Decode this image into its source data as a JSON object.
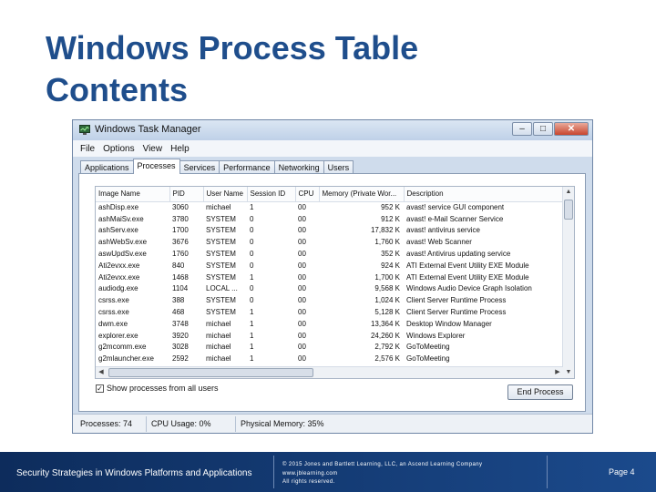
{
  "slide": {
    "title_line1": "Windows Process Table",
    "title_line2": "Contents"
  },
  "window": {
    "title": "Windows Task Manager",
    "minimize_glyph": "–",
    "maximize_glyph": "□",
    "close_glyph": "✕"
  },
  "menu": [
    "File",
    "Options",
    "View",
    "Help"
  ],
  "tabs": [
    "Applications",
    "Processes",
    "Services",
    "Performance",
    "Networking",
    "Users"
  ],
  "active_tab": "Processes",
  "columns": [
    "Image Name",
    "PID",
    "User Name",
    "Session ID",
    "CPU",
    "Memory (Private Wor...",
    "Description"
  ],
  "processes": [
    [
      "ashDisp.exe",
      "3060",
      "michael",
      "1",
      "00",
      "952 K",
      "avast! service GUI component"
    ],
    [
      "ashMaiSv.exe",
      "3780",
      "SYSTEM",
      "0",
      "00",
      "912 K",
      "avast! e-Mail Scanner Service"
    ],
    [
      "ashServ.exe",
      "1700",
      "SYSTEM",
      "0",
      "00",
      "17,832 K",
      "avast! antivirus service"
    ],
    [
      "ashWebSv.exe",
      "3676",
      "SYSTEM",
      "0",
      "00",
      "1,760 K",
      "avast! Web Scanner"
    ],
    [
      "aswUpdSv.exe",
      "1760",
      "SYSTEM",
      "0",
      "00",
      "352 K",
      "avast! Antivirus updating service"
    ],
    [
      "Ati2evxx.exe",
      "840",
      "SYSTEM",
      "0",
      "00",
      "924 K",
      "ATI External Event Utility EXE Module"
    ],
    [
      "Ati2evxx.exe",
      "1468",
      "SYSTEM",
      "1",
      "00",
      "1,700 K",
      "ATI External Event Utility EXE Module"
    ],
    [
      "audiodg.exe",
      "1104",
      "LOCAL ...",
      "0",
      "00",
      "9,568 K",
      "Windows Audio Device Graph Isolation"
    ],
    [
      "csrss.exe",
      "388",
      "SYSTEM",
      "0",
      "00",
      "1,024 K",
      "Client Server Runtime Process"
    ],
    [
      "csrss.exe",
      "468",
      "SYSTEM",
      "1",
      "00",
      "5,128 K",
      "Client Server Runtime Process"
    ],
    [
      "dwm.exe",
      "3748",
      "michael",
      "1",
      "00",
      "13,364 K",
      "Desktop Window Manager"
    ],
    [
      "explorer.exe",
      "3920",
      "michael",
      "1",
      "00",
      "24,260 K",
      "Windows Explorer"
    ],
    [
      "g2mcomm.exe",
      "3028",
      "michael",
      "1",
      "00",
      "2,792 K",
      "GoToMeeting"
    ],
    [
      "g2mlauncher.exe",
      "2592",
      "michael",
      "1",
      "00",
      "2,576 K",
      "GoToMeeting"
    ]
  ],
  "show_all_label": "Show processes from all users",
  "show_all_checked_glyph": "✓",
  "end_process_label": "End Process",
  "status": {
    "processes": "Processes: 74",
    "cpu": "CPU Usage: 0%",
    "memory": "Physical Memory: 35%"
  },
  "footer": {
    "course": "Security Strategies in Windows Platforms and Applications",
    "copyright_line1": "© 2015 Jones and Bartlett Learning, LLC, an Ascend Learning Company",
    "copyright_line2": "www.jblearning.com",
    "copyright_line3": "All rights reserved.",
    "page": "Page 4"
  },
  "colors": {
    "title": "#1f4e8c",
    "footer_bg": "#0d2c5c",
    "window_frame": "#cfdcec"
  },
  "icons": {
    "app_icon": "task-manager-icon",
    "checkbox": "checkmark-icon"
  }
}
